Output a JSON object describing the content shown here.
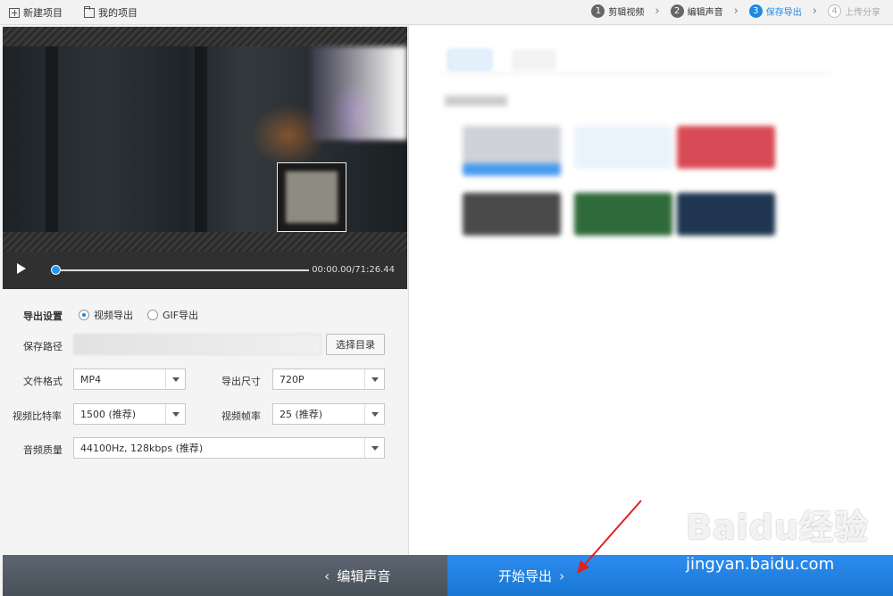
{
  "topbar": {
    "new_project": "新建项目",
    "my_projects": "我的项目",
    "steps": [
      {
        "num": "1",
        "label": "剪辑视频"
      },
      {
        "num": "2",
        "label": "编辑声音"
      },
      {
        "num": "3",
        "label": "保存导出"
      },
      {
        "num": "4",
        "label": "上传分享"
      }
    ]
  },
  "player": {
    "time": "00:00.00/71:26.44",
    "progress": 0.0
  },
  "export": {
    "section_label": "导出设置",
    "radio_video": "视频导出",
    "radio_gif": "GIF导出",
    "selected": "视频导出",
    "save_path_label": "保存路径",
    "choose_dir_button": "选择目录",
    "format_label": "文件格式",
    "format_value": "MP4",
    "size_label": "导出尺寸",
    "size_value": "720P",
    "bitrate_label": "视频比特率",
    "bitrate_value": "1500 (推荐)",
    "framerate_label": "视频帧率",
    "framerate_value": "25 (推荐)",
    "audio_label": "音频质量",
    "audio_value": "44100Hz, 128kbps (推荐)"
  },
  "bottom": {
    "back_button": "编辑声音",
    "start_button": "开始导出"
  },
  "watermark": {
    "brand": "Baidu经验",
    "url": "jingyan.baidu.com"
  },
  "colors": {
    "accent": "#1e88e5",
    "bottom_left": "#515a63",
    "bottom_right": "#2182e6",
    "annotation_arrow": "#e02020"
  }
}
